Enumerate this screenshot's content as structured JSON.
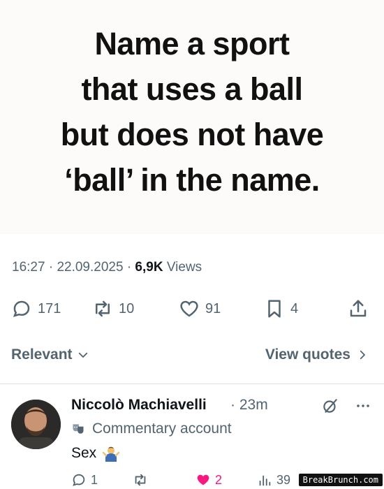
{
  "quote": {
    "text": "Name a sport\nthat uses a ball\nbut does not have\n‘ball’ in the name."
  },
  "meta": {
    "time": "16:27",
    "sep1": "·",
    "date": "22.09.2025",
    "sep2": "·",
    "views_count": "6,9K",
    "views_label": "Views"
  },
  "actions": {
    "replies": "171",
    "reposts": "10",
    "likes": "91",
    "bookmarks": "4"
  },
  "sort": {
    "relevant_label": "Relevant",
    "view_quotes_label": "View quotes"
  },
  "reply": {
    "name": "Niccolò Machiavelli",
    "time_sep": "·",
    "time": "23m",
    "label": "Commentary account",
    "text": "Sex",
    "actions": {
      "replies": "1",
      "likes": "2",
      "views": "39"
    },
    "colors": {
      "like_active": "#f91880"
    }
  },
  "watermark": "BreakBrunch.com",
  "colors": {
    "muted": "#536471",
    "text": "#0f1419",
    "card_bg": "#fcfbf9",
    "divider": "#dfe3e6"
  },
  "icons": {
    "reply": "speech-bubble-icon",
    "repost": "repost-icon",
    "like": "heart-icon",
    "bookmark": "bookmark-icon",
    "share": "share-icon",
    "chevron_down": "chevron-down-icon",
    "chevron_right": "chevron-right-icon",
    "grok": "grok-icon",
    "more": "more-icon",
    "views": "views-icon",
    "label_badge": "theater-masks-icon",
    "emoji": "person-shrugging-emoji"
  }
}
